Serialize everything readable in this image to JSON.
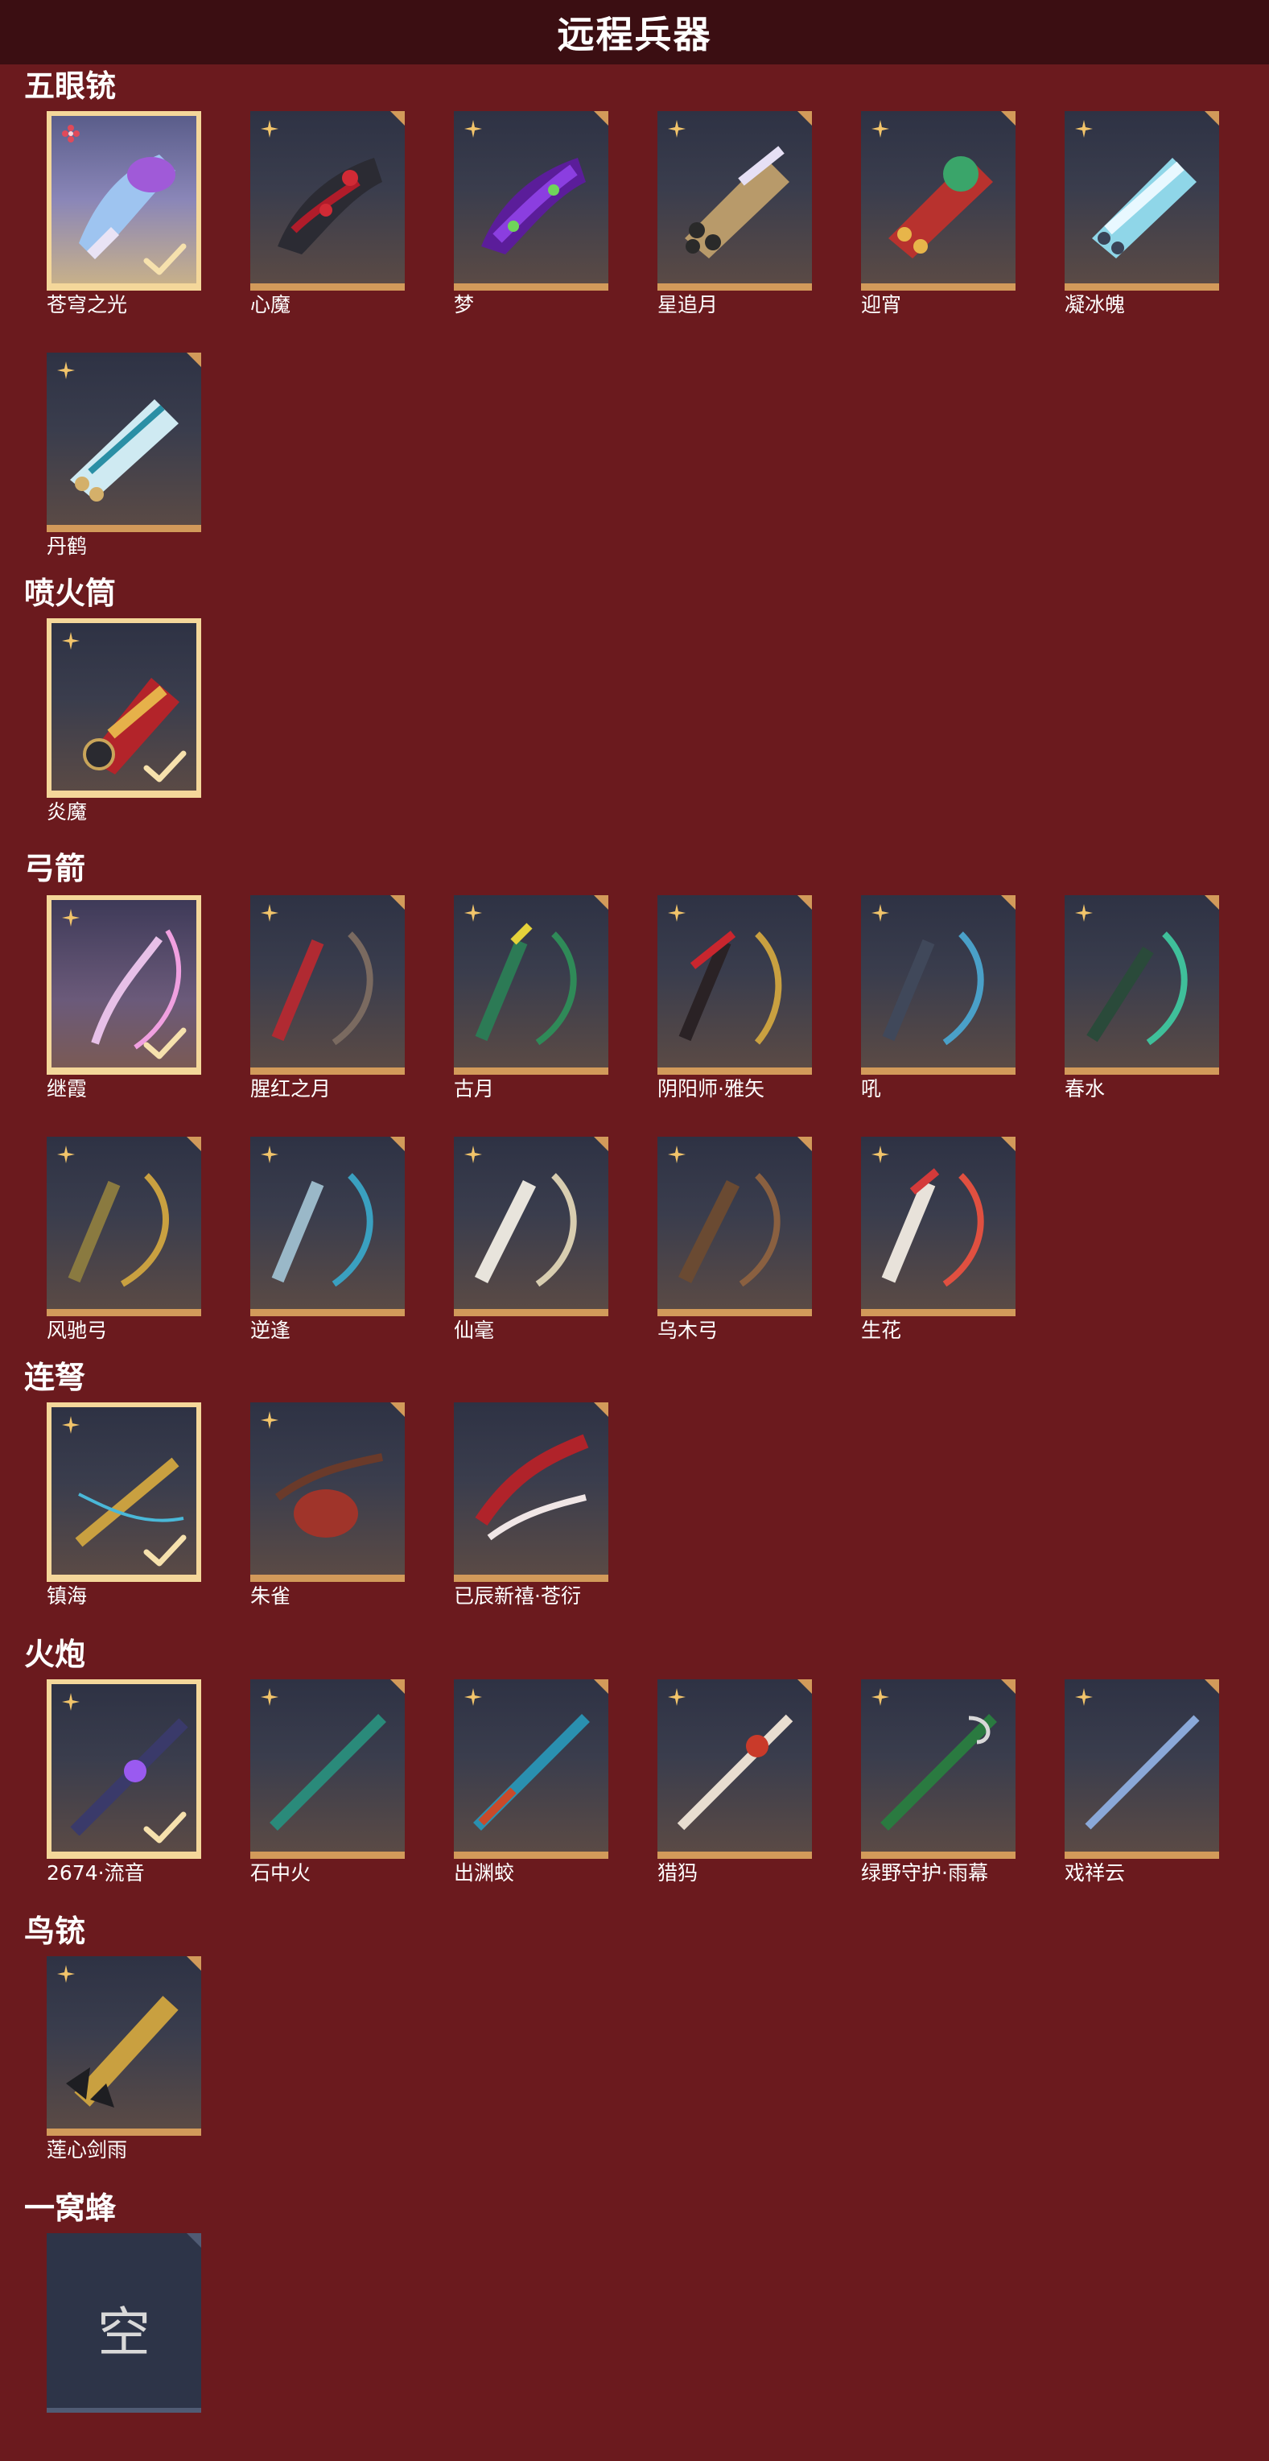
{
  "header": {
    "title": "远程兵器"
  },
  "sections": [
    {
      "title": "五眼铳",
      "items": [
        "苍穹之光",
        "心魔",
        "梦",
        "星追月",
        "迎宵",
        "凝冰魄",
        "丹鹤"
      ]
    },
    {
      "title": "喷火筒",
      "items": [
        "炎魔"
      ]
    },
    {
      "title": "弓箭",
      "items": [
        "继霞",
        "腥红之月",
        "古月",
        "阴阳师·雅矢",
        "吼",
        "春水",
        "风驰弓",
        "逆逢",
        "仙毫",
        "乌木弓",
        "生花"
      ]
    },
    {
      "title": "连弩",
      "items": [
        "镇海",
        "朱雀",
        "已辰新禧·苍衍"
      ]
    },
    {
      "title": "火炮",
      "items": [
        "2674·流音",
        "石中火",
        "出渊蛟",
        "猎犸",
        "绿野守护·雨幕",
        "戏祥云"
      ]
    },
    {
      "title": "鸟铳",
      "items": [
        "莲心剑雨"
      ]
    },
    {
      "title": "一窝蜂",
      "empty_label": "空"
    }
  ],
  "colors": {
    "background": "#6b1a1e",
    "header_bar": "#3b0e12",
    "card_border": "#d29a5a",
    "selected_border": "#f4d79a"
  },
  "icons": {
    "rarity": "four-point-star-icon",
    "rarity_special": "red-flower-icon",
    "equipped": "checkmark-icon"
  }
}
